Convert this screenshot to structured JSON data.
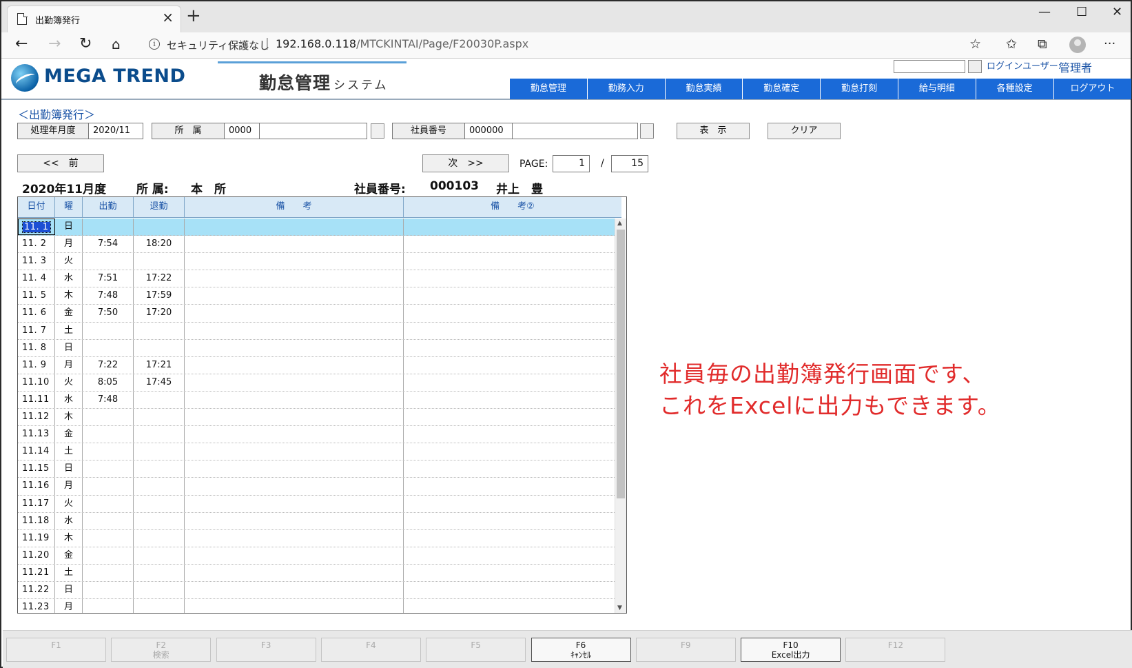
{
  "browser": {
    "tab_title": "出勤簿発行",
    "tab_close": "×",
    "new_tab": "+",
    "window_minimize": "—",
    "window_maximize": "☐",
    "window_close": "✕",
    "security_text": "セキュリティ保護なし",
    "separator": "|",
    "url_host": "192.168.0.118",
    "url_path": "/MTCKINTAI/Page/F20030P.aspx"
  },
  "header": {
    "logo_text": "MEGA TREND",
    "system_title": "勤怠管理",
    "system_subtitle": "システム",
    "login_label": "ログインユーザー:",
    "login_user": "管理者",
    "menu": [
      "勤怠管理",
      "勤務入力",
      "勤怠実績",
      "勤怠確定",
      "勤怠打刻",
      "給与明細",
      "各種設定",
      "ログアウト"
    ]
  },
  "form": {
    "screen_title": "＜出勤簿発行＞",
    "period_label": "処理年月度",
    "period_value": "2020/11",
    "dept_label": "所　属",
    "dept_code": "0000",
    "dept_name": "",
    "emp_label": "社員番号",
    "emp_code": "000000",
    "emp_name": "",
    "show_button": "表　示",
    "clear_button": "クリア",
    "prev_button": "<<　前",
    "next_button": "次　>>",
    "page_label": "PAGE:",
    "page_current": "1",
    "page_slash": "/",
    "page_total": "15"
  },
  "record": {
    "month": "2020年11月度",
    "dept_label": "所 属:",
    "dept_value": "本　所",
    "emp_label": "社員番号:",
    "emp_no": "000103",
    "emp_name": "井上　豊"
  },
  "table": {
    "headers": [
      "日付",
      "曜",
      "出勤",
      "退勤",
      "備　　考",
      "備　　考②"
    ],
    "rows": [
      {
        "date": "11. 1",
        "day": "日",
        "in": "",
        "out": ""
      },
      {
        "date": "11. 2",
        "day": "月",
        "in": "7:54",
        "out": "18:20"
      },
      {
        "date": "11. 3",
        "day": "火",
        "in": "",
        "out": ""
      },
      {
        "date": "11. 4",
        "day": "水",
        "in": "7:51",
        "out": "17:22"
      },
      {
        "date": "11. 5",
        "day": "木",
        "in": "7:48",
        "out": "17:59"
      },
      {
        "date": "11. 6",
        "day": "金",
        "in": "7:50",
        "out": "17:20"
      },
      {
        "date": "11. 7",
        "day": "土",
        "in": "",
        "out": ""
      },
      {
        "date": "11. 8",
        "day": "日",
        "in": "",
        "out": ""
      },
      {
        "date": "11. 9",
        "day": "月",
        "in": "7:22",
        "out": "17:21"
      },
      {
        "date": "11.10",
        "day": "火",
        "in": "8:05",
        "out": "17:45"
      },
      {
        "date": "11.11",
        "day": "水",
        "in": "7:48",
        "out": ""
      },
      {
        "date": "11.12",
        "day": "木",
        "in": "",
        "out": ""
      },
      {
        "date": "11.13",
        "day": "金",
        "in": "",
        "out": ""
      },
      {
        "date": "11.14",
        "day": "土",
        "in": "",
        "out": ""
      },
      {
        "date": "11.15",
        "day": "日",
        "in": "",
        "out": ""
      },
      {
        "date": "11.16",
        "day": "月",
        "in": "",
        "out": ""
      },
      {
        "date": "11.17",
        "day": "火",
        "in": "",
        "out": ""
      },
      {
        "date": "11.18",
        "day": "水",
        "in": "",
        "out": ""
      },
      {
        "date": "11.19",
        "day": "木",
        "in": "",
        "out": ""
      },
      {
        "date": "11.20",
        "day": "金",
        "in": "",
        "out": ""
      },
      {
        "date": "11.21",
        "day": "土",
        "in": "",
        "out": ""
      },
      {
        "date": "11.22",
        "day": "日",
        "in": "",
        "out": ""
      },
      {
        "date": "11.23",
        "day": "月",
        "in": "",
        "out": ""
      }
    ],
    "selected_index": 0
  },
  "annotation": {
    "line1": "社員毎の出勤簿発行画面です、",
    "line2": "これをExcelに出力もできます。"
  },
  "fkeys": [
    {
      "key": "F1",
      "label": "",
      "enabled": false
    },
    {
      "key": "F2",
      "label": "検索",
      "enabled": false
    },
    {
      "key": "F3",
      "label": "",
      "enabled": false
    },
    {
      "key": "F4",
      "label": "",
      "enabled": false
    },
    {
      "key": "F5",
      "label": "",
      "enabled": false
    },
    {
      "key": "F6",
      "label": "ｷｬﾝｾﾙ",
      "enabled": true
    },
    {
      "key": "F9",
      "label": "",
      "enabled": false
    },
    {
      "key": "F10",
      "label": "Excel出力",
      "enabled": true
    },
    {
      "key": "F12",
      "label": "",
      "enabled": false
    }
  ],
  "icons": {
    "back": "back-arrow-icon",
    "forward": "forward-arrow-icon",
    "refresh": "refresh-icon",
    "home": "home-icon",
    "info": "info-icon",
    "favorite": "star-icon",
    "favorites_list": "favorites-icon",
    "collections": "collections-icon",
    "profile": "avatar-icon",
    "more": "more-icon"
  },
  "colors": {
    "menu_bg": "#1a6ad8",
    "accent_text": "#1a53a6",
    "annotation": "#e12b2b",
    "selected_row": "#a7e1f7"
  }
}
